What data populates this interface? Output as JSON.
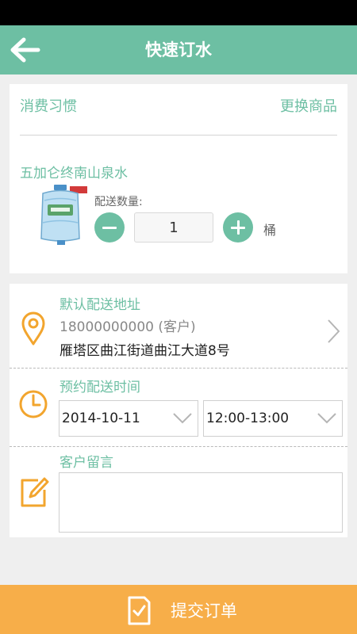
{
  "header": {
    "title": "快速订水",
    "back_icon": "arrow-left-icon"
  },
  "product_card": {
    "habit_label": "消费习惯",
    "change_label": "更换商品",
    "product_name": "五加仑终南山泉水",
    "quantity_label": "配送数量:",
    "quantity_value": "1",
    "unit": "桶"
  },
  "delivery": {
    "address_heading": "默认配送地址",
    "phone": "18000000000 (客户)",
    "address": "雁塔区曲江街道曲江大道8号",
    "time_heading": "预约配送时间",
    "date_value": "2014-10-11",
    "time_value": "12:00-13:00",
    "message_heading": "客户留言",
    "message_value": ""
  },
  "submit": {
    "label": "提交订单"
  },
  "colors": {
    "primary": "#6dbfa3",
    "accent": "#f7ae49",
    "background": "#efefef"
  }
}
